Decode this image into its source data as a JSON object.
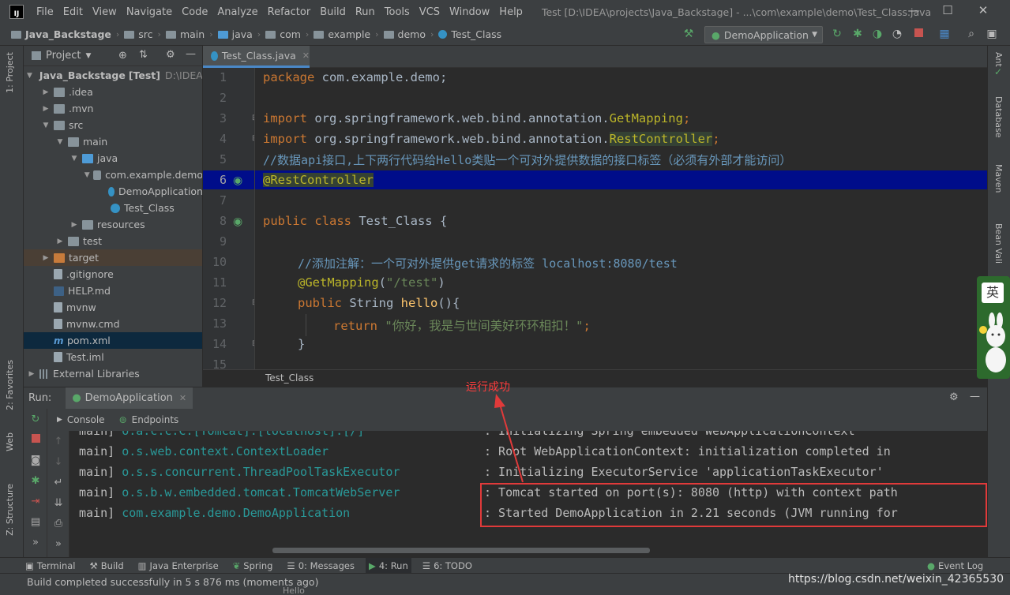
{
  "app": {
    "logo": "IJ",
    "window_title": "Test [D:\\IDEA\\projects\\Java_Backstage] - ...\\com\\example\\demo\\Test_Class.java",
    "menu": [
      "File",
      "Edit",
      "View",
      "Navigate",
      "Code",
      "Analyze",
      "Refactor",
      "Build",
      "Run",
      "Tools",
      "VCS",
      "Window",
      "Help"
    ],
    "window_controls": {
      "minimize": "—",
      "maximize": "☐",
      "close": "✕"
    }
  },
  "navbar": {
    "breadcrumbs": [
      "Java_Backstage",
      "src",
      "main",
      "java",
      "com",
      "example",
      "demo",
      "Test_Class"
    ],
    "run_config": "DemoApplication"
  },
  "left_stripe": {
    "project_tab": "1: Project",
    "favorites_tab": "2: Favorites",
    "web_tab": "Web",
    "structure_tab": "Z: Structure"
  },
  "project_panel": {
    "title": "Project",
    "tree": [
      {
        "label": "Java_Backstage",
        "suffix": "[Test]",
        "path": "D:\\IDEA\\",
        "depth": 0,
        "arrow": "▼",
        "icon": "folder"
      },
      {
        "label": ".idea",
        "depth": 1,
        "arrow": "▶",
        "icon": "folder"
      },
      {
        "label": ".mvn",
        "depth": 1,
        "arrow": "▶",
        "icon": "folder"
      },
      {
        "label": "src",
        "depth": 1,
        "arrow": "▼",
        "icon": "folder"
      },
      {
        "label": "main",
        "depth": 2,
        "arrow": "▼",
        "icon": "folder"
      },
      {
        "label": "java",
        "depth": 3,
        "arrow": "▼",
        "icon": "folder-blue"
      },
      {
        "label": "com.example.demo",
        "depth": 4,
        "arrow": "▼",
        "icon": "pkg"
      },
      {
        "label": "DemoApplication",
        "depth": 5,
        "arrow": "",
        "icon": "class"
      },
      {
        "label": "Test_Class",
        "depth": 5,
        "arrow": "",
        "icon": "class"
      },
      {
        "label": "resources",
        "depth": 3,
        "arrow": "▶",
        "icon": "folder"
      },
      {
        "label": "test",
        "depth": 2,
        "arrow": "▶",
        "icon": "folder"
      },
      {
        "label": "target",
        "depth": 1,
        "arrow": "▶",
        "icon": "folder-orange",
        "state": "excluded"
      },
      {
        "label": ".gitignore",
        "depth": 1,
        "arrow": "",
        "icon": "file"
      },
      {
        "label": "HELP.md",
        "depth": 1,
        "arrow": "",
        "icon": "md"
      },
      {
        "label": "mvnw",
        "depth": 1,
        "arrow": "",
        "icon": "file"
      },
      {
        "label": "mvnw.cmd",
        "depth": 1,
        "arrow": "",
        "icon": "file"
      },
      {
        "label": "pom.xml",
        "depth": 1,
        "arrow": "",
        "icon": "maven",
        "state": "selected"
      },
      {
        "label": "Test.iml",
        "depth": 1,
        "arrow": "",
        "icon": "file"
      },
      {
        "label": "External Libraries",
        "depth": 0,
        "arrow": "▶",
        "icon": "lib"
      }
    ]
  },
  "editor": {
    "tab": "Test_Class.java",
    "breadcrumb": "Test_Class",
    "line_numbers": [
      "1",
      "2",
      "3",
      "4",
      "5",
      "6",
      "7",
      "8",
      "9",
      "10",
      "11",
      "12",
      "13",
      "14",
      "15"
    ],
    "lines": {
      "l1_kw": "package",
      "l1_rest": " com.example.demo;",
      "l3_kw": "import",
      "l3_rest": " org.springframework.web.bind.annotation.",
      "l3_cls": "GetMapping",
      "l3_end": ";",
      "l4_kw": "import",
      "l4_rest": " org.springframework.web.bind.annotation.",
      "l4_cls": "RestController",
      "l4_end": ";",
      "l5_comment": "//数据api接口,上下两行代码给Hello类贴一个可对外提供数据的接口标签（必须有外部才能访问）",
      "l6_ann": "@RestController",
      "l8_kw": "public class",
      "l8_rest": " Test_Class {",
      "l10_comment": "//添加注解：一个可对外提供get请求的标签",
      "l10_url": " localhost:8080/test",
      "l11_ann": "@GetMapping",
      "l11_open": "(",
      "l11_str": "\"/test\"",
      "l11_close": ")",
      "l12_kw": "public",
      "l12_type": " String ",
      "l12_fn": "hello",
      "l12_rest": "(){",
      "l13_kw": "return",
      "l13_str": " \"你好，我是与世间美好环环相扣！\"",
      "l13_end": ";",
      "l14": "}"
    }
  },
  "right_stripe": {
    "ant": "Ant",
    "database": "Database",
    "maven": "Maven",
    "bean": "Bean Vali"
  },
  "ime": {
    "char": "英"
  },
  "run_panel": {
    "label": "Run:",
    "config_tab": "DemoApplication",
    "console_tab": "Console",
    "endpoints_tab": "Endpoints",
    "log": [
      {
        "thread": "main]",
        "logger": "o.a.c.c.C.[Tomcat].[localhost].[/]",
        "msg": ": Initializing Spring embedded WebApplicationContext"
      },
      {
        "thread": "main]",
        "logger": "o.s.web.context.ContextLoader",
        "msg": ": Root WebApplicationContext: initialization completed in"
      },
      {
        "thread": "main]",
        "logger": "o.s.s.concurrent.ThreadPoolTaskExecutor",
        "msg": ": Initializing ExecutorService 'applicationTaskExecutor'"
      },
      {
        "thread": "main]",
        "logger": "o.s.b.w.embedded.tomcat.TomcatWebServer",
        "msg": ": Tomcat started on port(s): 8080 (http) with context path"
      },
      {
        "thread": "main]",
        "logger": "com.example.demo.DemoApplication",
        "msg": ": Started DemoApplication in 2.21 seconds (JVM running for"
      }
    ]
  },
  "annotation": {
    "label": "运行成功"
  },
  "bottom_tools": {
    "terminal": "Terminal",
    "build": "Build",
    "java_enterprise": "Java Enterprise",
    "spring": "Spring",
    "messages": "0: Messages",
    "run": "4: Run",
    "todo": "6: TODO",
    "event_log": "Event Log"
  },
  "status": {
    "message": "Build completed successfully in 5 s 876 ms (moments ago)",
    "hello": "Hello"
  },
  "watermark": "https://blog.csdn.net/weixin_42365530",
  "colors": {
    "accent": "#4a88c7",
    "selection": "#000d8a",
    "annotation": "#e03a3a"
  }
}
